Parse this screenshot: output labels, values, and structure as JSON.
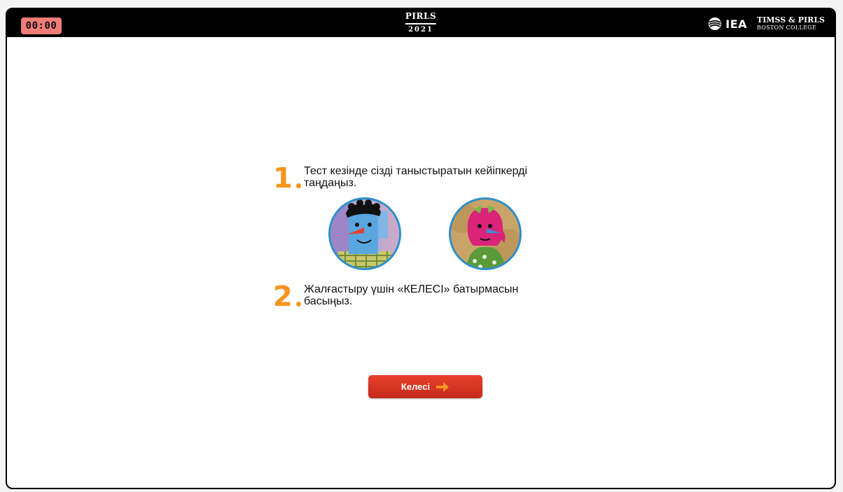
{
  "header": {
    "timer": "00:00",
    "logo_name": "PIRLS",
    "logo_year": "2021",
    "iea_text": "IEA",
    "org_line1": "TIMSS & PIRLS",
    "org_line2": "BOSTON COLLEGE"
  },
  "steps": [
    {
      "number": "1",
      "text": "Тест кезінде сізді таныстыратын кейіпкерді таңдаңыз."
    },
    {
      "number": "2",
      "text": "Жалғастыру үшін «КЕЛЕСІ» батырмасын басыңыз."
    }
  ],
  "avatars": [
    {
      "icon": "boy-avatar-icon",
      "ring_color": "#2e8fc9"
    },
    {
      "icon": "girl-avatar-icon",
      "ring_color": "#2e8fc9"
    }
  ],
  "next_button": {
    "label": "Келесі",
    "icon": "arrow-right-icon",
    "color": "#e03a27",
    "arrow_color": "#f7941d"
  },
  "colors": {
    "timer_bg": "#f07c78",
    "accent_orange": "#f7941d",
    "topbar": "#000000"
  }
}
